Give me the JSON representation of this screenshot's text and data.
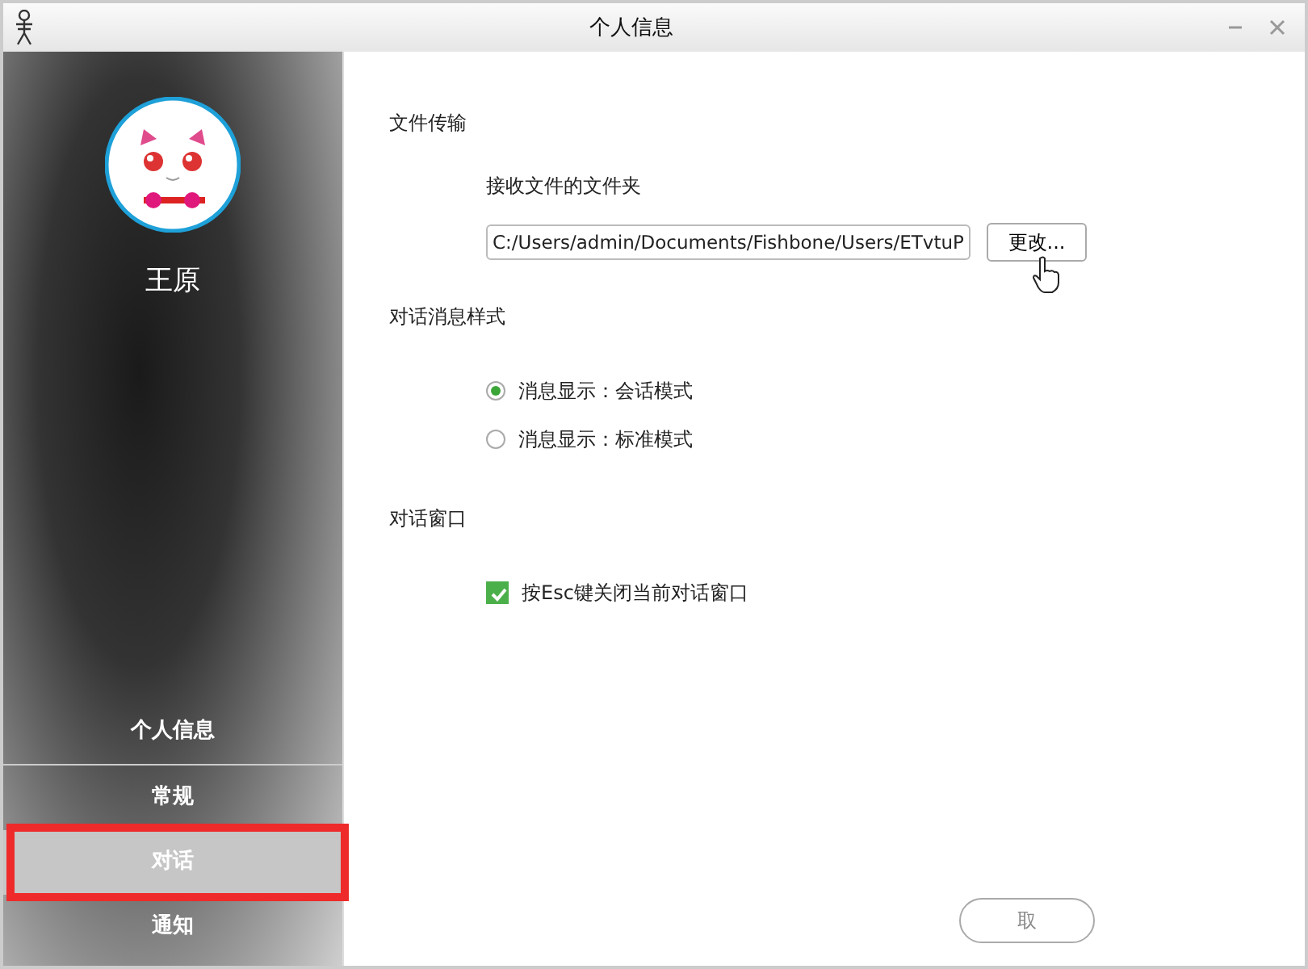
{
  "window": {
    "title": "个人信息"
  },
  "sidebar": {
    "user_name": "王原",
    "items": [
      {
        "label": "个人信息",
        "selected": false
      },
      {
        "label": "常规",
        "selected": false
      },
      {
        "label": "对话",
        "selected": true,
        "highlighted": true
      },
      {
        "label": "通知",
        "selected": false
      }
    ]
  },
  "sections": [
    {
      "title": "文件传输",
      "kind": "folder",
      "label": "接收文件的文件夹",
      "value": "C:/Users/admin/Documents/Fishbone/Users/ETvtuP",
      "button": "更改..."
    },
    {
      "title": "对话消息样式",
      "kind": "radios",
      "options": [
        {
          "label": "消息显示：会话模式",
          "selected": true
        },
        {
          "label": "消息显示：标准模式",
          "selected": false
        }
      ]
    },
    {
      "title": "对话窗口",
      "kind": "checks",
      "options": [
        {
          "label": "按Esc键关闭当前对话窗口",
          "checked": true
        }
      ]
    }
  ],
  "buttons": [
    "取"
  ]
}
